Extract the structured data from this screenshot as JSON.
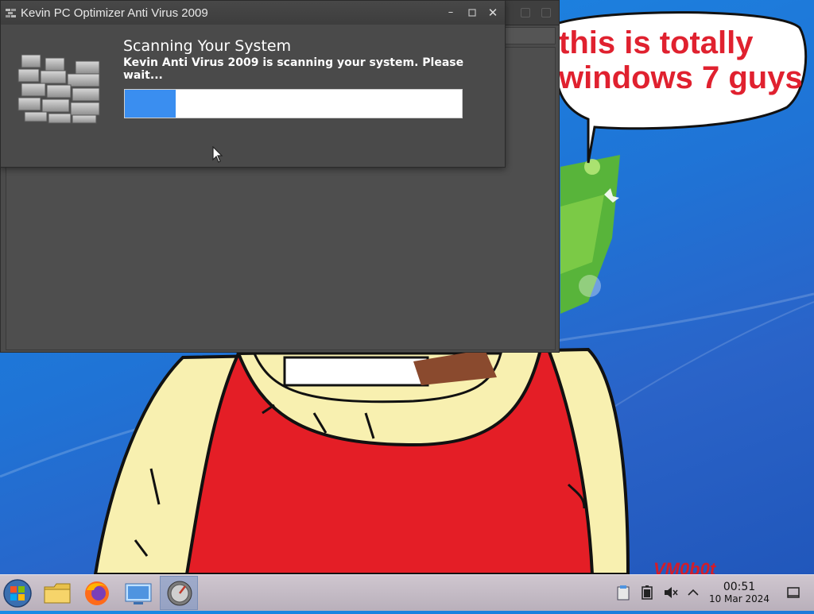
{
  "dialog": {
    "title": "Kevin PC Optimizer Anti Virus 2009",
    "heading": "Scanning Your System",
    "message": "Kevin Anti Virus 2009 is scanning your system. Please wait...",
    "progress_fraction": 0.15
  },
  "wallpaper": {
    "speech_text": "this is totally\nwindows 7 guys",
    "watermark": "VM0b0t"
  },
  "taskbar": {
    "apps": [
      {
        "name": "start-button-icon"
      },
      {
        "name": "file-manager-icon"
      },
      {
        "name": "firefox-icon"
      },
      {
        "name": "control-panel-icon"
      },
      {
        "name": "antivirus-app-icon"
      }
    ],
    "tray": [
      "clipboard-icon",
      "battery-icon",
      "muted-speaker-icon",
      "chevron-up-icon"
    ],
    "time": "00:51",
    "date": "10 Mar 2024"
  },
  "colors": {
    "accent": "#3a8ef0",
    "speech": "#e0212f",
    "shirt": "#e41e26",
    "skin": "#f8f0b0"
  }
}
